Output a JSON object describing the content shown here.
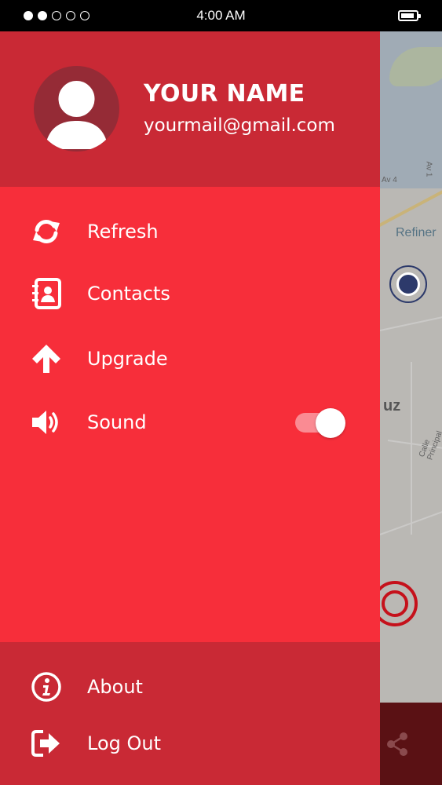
{
  "status_bar": {
    "signal_dots_filled": 2,
    "signal_dots_total": 5,
    "time": "4:00 AM",
    "battery_icon": "battery-icon"
  },
  "profile": {
    "name": "YOUR NAME",
    "email": "yourmail@gmail.com",
    "avatar_icon": "user-avatar-icon"
  },
  "menu": {
    "items": [
      {
        "label": "Refresh",
        "icon": "refresh-icon"
      },
      {
        "label": "Contacts",
        "icon": "contacts-book-icon"
      },
      {
        "label": "Upgrade",
        "icon": "arrow-up-icon"
      },
      {
        "label": "Sound",
        "icon": "speaker-volume-icon",
        "toggle_on": true
      }
    ]
  },
  "footer": {
    "items": [
      {
        "label": "About",
        "icon": "info-circle-icon"
      },
      {
        "label": "Log Out",
        "icon": "logout-icon"
      }
    ]
  },
  "map": {
    "labels": [
      "Av 4",
      "Av 1",
      "Refiner",
      "uz",
      "Calle Principal"
    ],
    "share_icon": "share-icon"
  },
  "colors": {
    "drawer_bg": "#f72e3a",
    "header_bg": "#c92935",
    "footer_bg": "#c92935",
    "avatar_bg": "#952b36",
    "toggle_track": "#fa8b93",
    "text": "#ffffff"
  }
}
